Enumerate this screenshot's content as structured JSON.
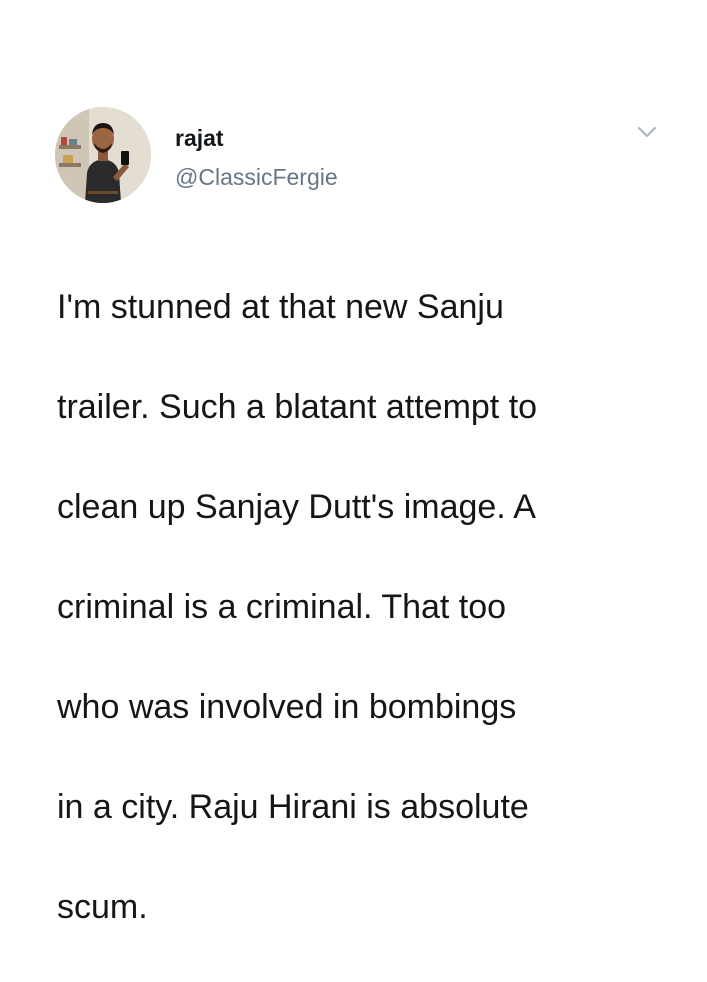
{
  "tweet": {
    "author": {
      "display_name": "rajat",
      "handle": "@ClassicFergie",
      "avatar_icon": "profile-photo"
    },
    "menu_icon": "chevron-down-icon",
    "text_lines": [
      "I'm stunned at that new Sanju",
      "trailer. Such a blatant attempt to",
      "clean up Sanjay Dutt's image. A",
      "criminal is a criminal. That too",
      "who was involved in bombings",
      "in a city. Raju Hirani is absolute",
      "scum."
    ]
  },
  "colors": {
    "background": "#ffffff",
    "text_primary": "#14171a",
    "text_secondary": "#657786",
    "chevron": "#aab8c2"
  }
}
